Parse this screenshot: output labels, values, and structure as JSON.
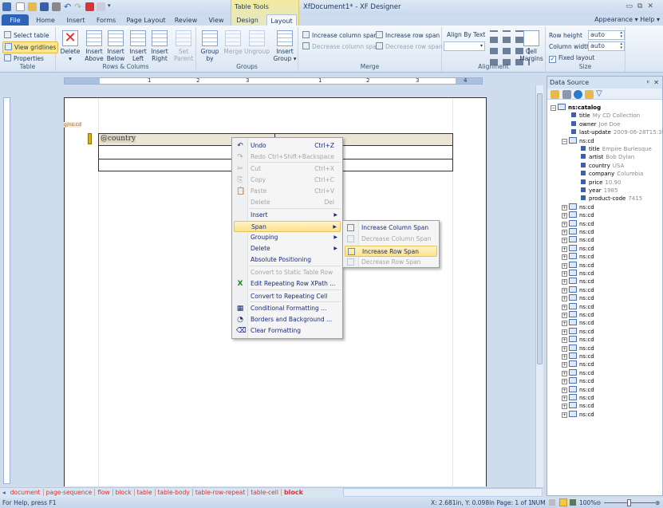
{
  "window": {
    "title": "XfDocument1* - XF Designer",
    "contextual_tab_group": "Table Tools",
    "minimize": "▭",
    "restore": "⧉",
    "close": "✕"
  },
  "tabs": [
    {
      "label": "File"
    },
    {
      "label": "Home"
    },
    {
      "label": "Insert"
    },
    {
      "label": "Forms"
    },
    {
      "label": "Page Layout"
    },
    {
      "label": "Review"
    },
    {
      "label": "View"
    },
    {
      "label": "Design"
    },
    {
      "label": "Layout",
      "active": true
    }
  ],
  "top_right": {
    "appearance": "Appearance ▾",
    "help": "Help ▾"
  },
  "ribbon": {
    "table": {
      "label": "Table",
      "select_table": "Select table",
      "view_gridlines": "View gridlines",
      "properties": "Properties"
    },
    "rows_columns": {
      "label": "Rows & Colums",
      "delete": "Delete",
      "insert_above": "Insert Above",
      "insert_below": "Insert Below",
      "insert_left": "Insert Left",
      "insert_right": "Insert Right",
      "set_parent": "Set Parent"
    },
    "groups": {
      "label": "Groups",
      "group_by": "Group by",
      "merge": "Merge",
      "ungroup": "Ungroup",
      "insert_group": "Insert Group ▾"
    },
    "merge": {
      "label": "Merge",
      "increase_column_span": "Increase column span",
      "increase_row_span": "Increase row span",
      "decrease_column_span": "Decrease column span",
      "decrease_row_span": "Decrease row span"
    },
    "alignment": {
      "label": "Alignment",
      "align_by_text": "Align By Text",
      "align_select_value": "",
      "cell_margins": "Cell Margins"
    },
    "size": {
      "label": "Size",
      "row_height_label": "Row height",
      "row_height": "auto",
      "column_width_label": "Column width",
      "column_width": "auto",
      "fixed_layout": "Fixed layout",
      "fixed_layout_checked": true
    }
  },
  "ruler": {
    "marks": [
      "1",
      "2",
      "3",
      "1",
      "2",
      "3",
      "4"
    ]
  },
  "document": {
    "xpath_tag": "g/ns:cd",
    "cell_text": "@country"
  },
  "context_menu": {
    "items": [
      {
        "label": "Undo",
        "shortcut": "Ctrl+Z",
        "enabled": true,
        "icon": "undo-icon"
      },
      {
        "label": "Redo",
        "shortcut": "Ctrl+Shift+Backspace",
        "enabled": false,
        "icon": "redo-icon"
      },
      {
        "label": "Cut",
        "shortcut": "Ctrl+X",
        "enabled": false,
        "icon": "cut-icon"
      },
      {
        "label": "Copy",
        "shortcut": "Ctrl+C",
        "enabled": false,
        "icon": "copy-icon"
      },
      {
        "label": "Paste",
        "shortcut": "Ctrl+V",
        "enabled": false,
        "icon": "paste-icon"
      },
      {
        "label": "Delete",
        "shortcut": "Del",
        "enabled": false
      },
      {
        "label": "Insert",
        "submenu": true,
        "enabled": true
      },
      {
        "label": "Span",
        "submenu": true,
        "enabled": true,
        "highlighted": true
      },
      {
        "label": "Grouping",
        "submenu": true,
        "enabled": true
      },
      {
        "label": "Delete",
        "submenu": true,
        "enabled": true
      },
      {
        "label": "Absolute Positioning",
        "enabled": true
      },
      {
        "label": "Convert to Static Table Row",
        "enabled": false
      },
      {
        "label": "Edit Repeating Row XPath ...",
        "enabled": true,
        "icon": "xpath-icon"
      },
      {
        "label": "Convert to Repeating Cell",
        "enabled": true
      },
      {
        "label": "Conditional Formatting ...",
        "enabled": true,
        "icon": "conditional-formatting-icon"
      },
      {
        "label": "Borders and Background ...",
        "enabled": true,
        "icon": "borders-icon"
      },
      {
        "label": "Clear Formatting",
        "enabled": true,
        "icon": "eraser-icon"
      }
    ]
  },
  "span_submenu": {
    "items": [
      {
        "label": "Increase Column Span",
        "enabled": true
      },
      {
        "label": "Decrease Column Span",
        "enabled": false
      },
      {
        "label": "Increase Row Span",
        "enabled": true,
        "highlighted": true
      },
      {
        "label": "Decrease Row Span",
        "enabled": false
      }
    ]
  },
  "breadcrumb": [
    "document",
    "page-sequence",
    "flow",
    "block",
    "table",
    "table-body",
    "table-row-repeat",
    "table-cell",
    "block"
  ],
  "status": {
    "help": "For Help, press F1",
    "position": "X: 2.681in, Y: 0.098in Page: 1 of 1",
    "num": "NUM",
    "zoom": "100%",
    "zoom_fraction": 0.5
  },
  "data_source": {
    "title": "Data Source",
    "pin": "ᵖ",
    "close": "✕",
    "root": "ns:catalog",
    "root_fields": [
      {
        "name": "title",
        "value": "My CD Collection"
      },
      {
        "name": "owner",
        "value": "Joe Doe"
      },
      {
        "name": "last-update",
        "value": "2009-06-28T15:39:"
      }
    ],
    "first_cd": "ns:cd",
    "cd_fields": [
      {
        "name": "title",
        "value": "Empire Burlesque"
      },
      {
        "name": "artist",
        "value": "Bob Dylan"
      },
      {
        "name": "country",
        "value": "USA"
      },
      {
        "name": "company",
        "value": "Columbia"
      },
      {
        "name": "price",
        "value": "10.90"
      },
      {
        "name": "year",
        "value": "1985"
      },
      {
        "name": "product-code",
        "value": "7415"
      }
    ],
    "collapsed_cds": [
      "ns:cd",
      "ns:cd",
      "ns:cd",
      "ns:cd",
      "ns:cd",
      "ns:cd",
      "ns:cd",
      "ns:cd",
      "ns:cd",
      "ns:cd",
      "ns:cd",
      "ns:cd",
      "ns:cd",
      "ns:cd",
      "ns:cd",
      "ns:cd",
      "ns:cd",
      "ns:cd",
      "ns:cd",
      "ns:cd",
      "ns:cd",
      "ns:cd",
      "ns:cd",
      "ns:cd",
      "ns:cd",
      "ns:cd"
    ]
  },
  "colors": {
    "accent": "#2a63b8",
    "highlight": "#fde78b",
    "breadcrumb": "#e03030"
  }
}
